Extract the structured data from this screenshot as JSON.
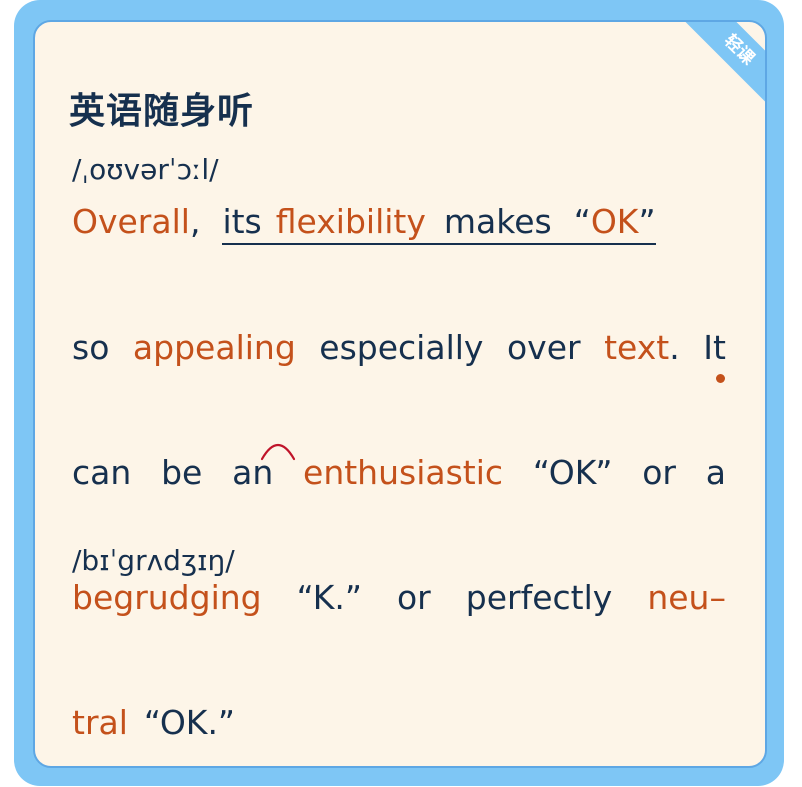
{
  "card": {
    "badge": "轻课",
    "title": "英语随身听",
    "phonetic_top": "/ˌoʊvərˈɔːl/",
    "phonetic_mid": "/bɪˈgrʌdʒɪŋ/"
  },
  "text": {
    "l1": [
      "Overall",
      ",",
      "its",
      "flexibility",
      "makes",
      "“",
      "OK",
      "”"
    ],
    "l2": [
      "so",
      "appealing",
      "especially",
      "over",
      "text",
      ".",
      "It"
    ],
    "l3": [
      "can",
      "be",
      "an",
      "enthusiastic",
      "“OK”",
      "or",
      "a"
    ],
    "l4": [
      "begrudging",
      "“K.”",
      "or",
      "perfectly",
      "neu–"
    ],
    "l5": [
      "tral",
      "“OK.”"
    ]
  },
  "colors": {
    "frame": "#7ec6f5",
    "border": "#5ea7e4",
    "card": "#fdf5e8",
    "text": "#16304e",
    "highlight": "#c4511b",
    "arc": "#c0142a"
  }
}
